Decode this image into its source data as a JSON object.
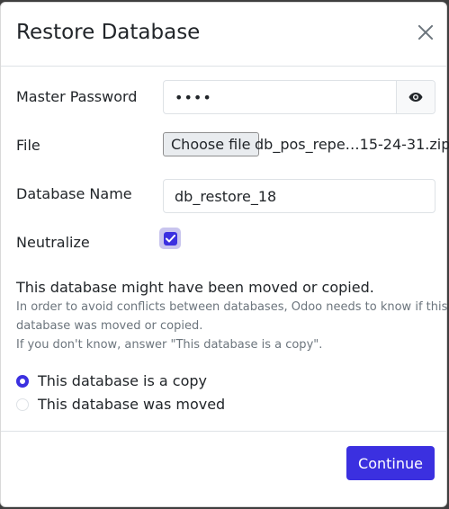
{
  "dialog": {
    "title": "Restore Database"
  },
  "form": {
    "master_password_label": "Master Password",
    "master_password_value": "••••",
    "file_label": "File",
    "file_button": "Choose file",
    "file_name": "db_pos_repe…15-24-31.zip",
    "db_name_label": "Database Name",
    "db_name_value": "db_restore_18",
    "neutralize_label": "Neutralize",
    "neutralize_checked": true
  },
  "info": {
    "title": "This database might have been moved or copied.",
    "line1": "In order to avoid conflicts between databases, Odoo needs to know if this",
    "line2": "database was moved or copied.",
    "line3": "If you don't know, answer \"This database is a copy\"."
  },
  "options": [
    {
      "label": "This database is a copy",
      "selected": true
    },
    {
      "label": "This database was moved",
      "selected": false
    }
  ],
  "footer": {
    "continue_label": "Continue"
  },
  "colors": {
    "primary": "#3b30e0",
    "muted_text": "#6c757d",
    "border": "#dee2e6"
  }
}
